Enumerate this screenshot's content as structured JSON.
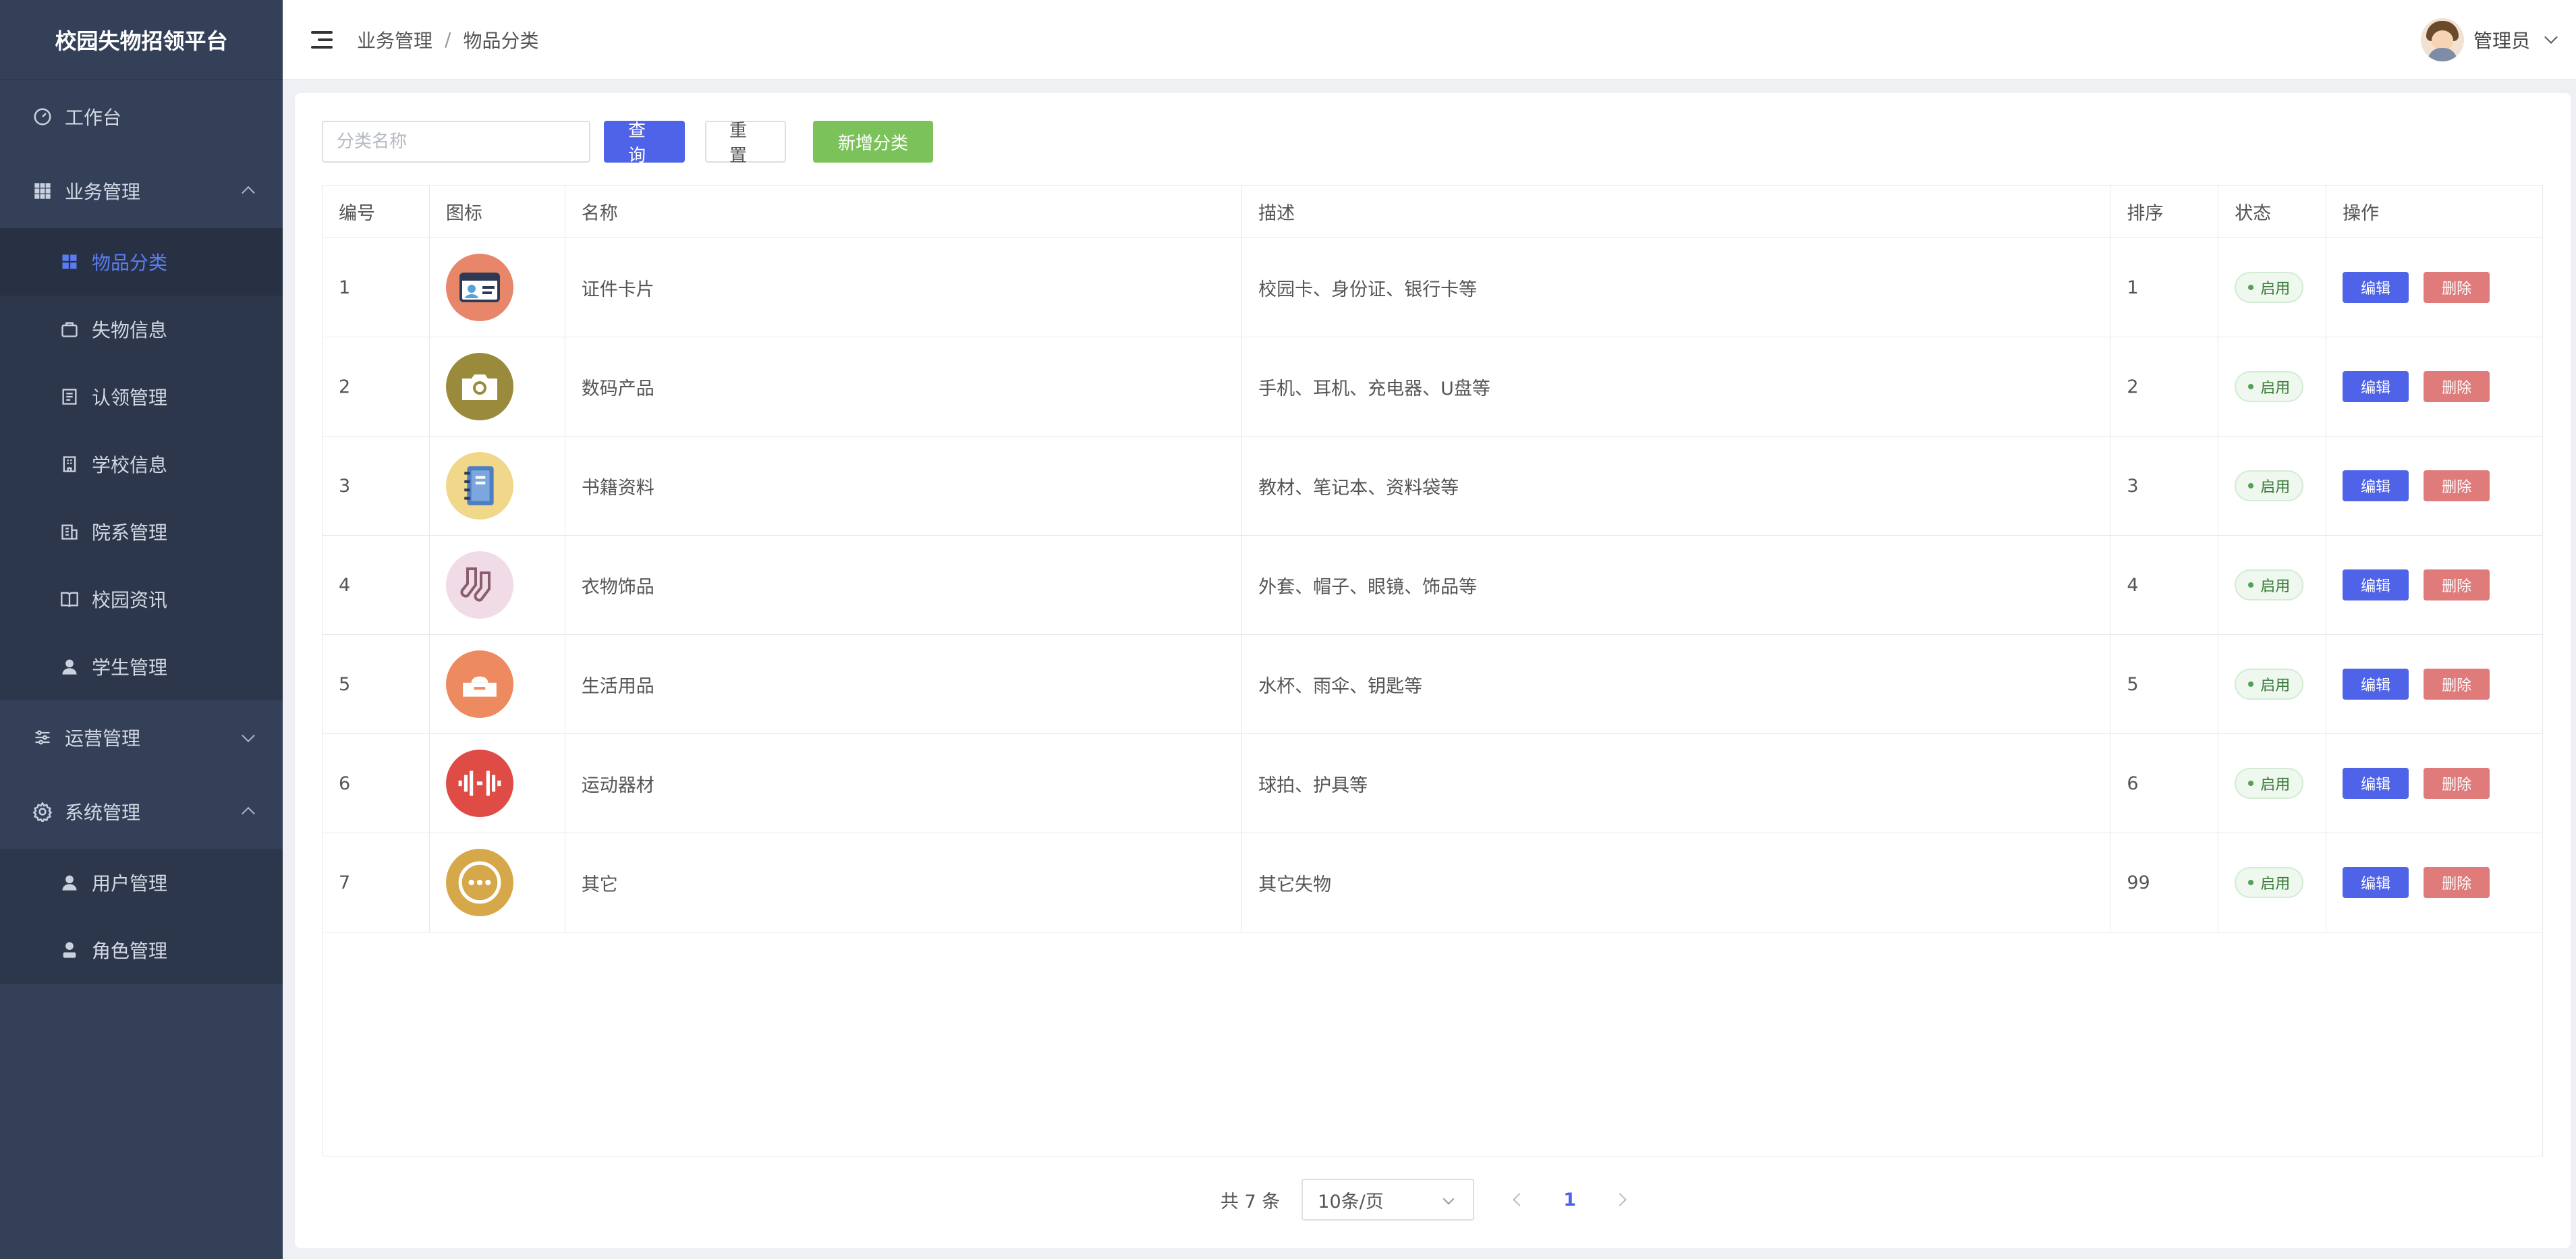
{
  "app": {
    "title": "校园失物招领平台"
  },
  "sidebar": {
    "items": [
      {
        "label": "工作台",
        "type": "top",
        "icon": "dashboard-icon"
      },
      {
        "label": "业务管理",
        "type": "top",
        "icon": "grid-icon",
        "expanded": true
      },
      {
        "label": "物品分类",
        "type": "sub",
        "icon": "category-icon",
        "active": true
      },
      {
        "label": "失物信息",
        "type": "sub",
        "icon": "bag-icon"
      },
      {
        "label": "认领管理",
        "type": "sub",
        "icon": "document-icon"
      },
      {
        "label": "学校信息",
        "type": "sub",
        "icon": "building-icon"
      },
      {
        "label": "院系管理",
        "type": "sub",
        "icon": "office-icon"
      },
      {
        "label": "校园资讯",
        "type": "sub",
        "icon": "book-icon"
      },
      {
        "label": "学生管理",
        "type": "sub",
        "icon": "user-icon"
      },
      {
        "label": "运营管理",
        "type": "top",
        "icon": "sliders-icon",
        "expanded": false
      },
      {
        "label": "系统管理",
        "type": "top",
        "icon": "gear-icon",
        "expanded": true
      },
      {
        "label": "用户管理",
        "type": "sub",
        "icon": "user-icon"
      },
      {
        "label": "角色管理",
        "type": "sub",
        "icon": "role-icon"
      }
    ]
  },
  "header": {
    "breadcrumb": [
      "业务管理",
      "物品分类"
    ],
    "user": "管理员"
  },
  "toolbar": {
    "search_placeholder": "分类名称",
    "query_label": "查询",
    "reset_label": "重置",
    "add_label": "新增分类"
  },
  "table": {
    "columns": [
      "编号",
      "图标",
      "名称",
      "描述",
      "排序",
      "状态",
      "操作"
    ],
    "edit_label": "编辑",
    "delete_label": "删除",
    "rows": [
      {
        "id": "1",
        "name": "证件卡片",
        "desc": "校园卡、身份证、银行卡等",
        "sort": "1",
        "status": "启用",
        "icon": "id-card-icon",
        "color": "#e8866a"
      },
      {
        "id": "2",
        "name": "数码产品",
        "desc": "手机、耳机、充电器、U盘等",
        "sort": "2",
        "status": "启用",
        "icon": "camera-icon",
        "color": "#9a8a3c"
      },
      {
        "id": "3",
        "name": "书籍资料",
        "desc": "教材、笔记本、资料袋等",
        "sort": "3",
        "status": "启用",
        "icon": "notebook-icon",
        "color": "#f1d78a"
      },
      {
        "id": "4",
        "name": "衣物饰品",
        "desc": "外套、帽子、眼镜、饰品等",
        "sort": "4",
        "status": "启用",
        "icon": "socks-icon",
        "color": "#f0dbe6"
      },
      {
        "id": "5",
        "name": "生活用品",
        "desc": "水杯、雨伞、钥匙等",
        "sort": "5",
        "status": "启用",
        "icon": "tissue-box-icon",
        "color": "#ee8a5f"
      },
      {
        "id": "6",
        "name": "运动器材",
        "desc": "球拍、护具等",
        "sort": "6",
        "status": "启用",
        "icon": "dumbbell-icon",
        "color": "#df4b45"
      },
      {
        "id": "7",
        "name": "其它",
        "desc": "其它失物",
        "sort": "99",
        "status": "启用",
        "icon": "more-icon",
        "color": "#d7a84a"
      }
    ]
  },
  "pagination": {
    "total_text": "共 7 条",
    "page_size": "10条/页",
    "current_page": "1"
  }
}
